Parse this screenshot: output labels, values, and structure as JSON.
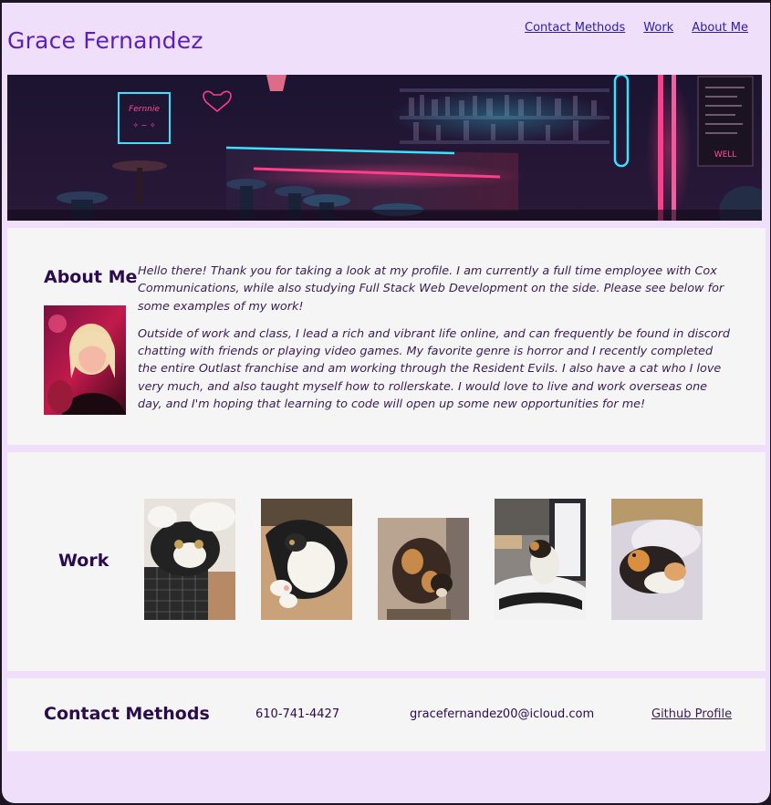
{
  "header": {
    "title": "Grace Fernandez",
    "nav": [
      {
        "label": "Contact Methods"
      },
      {
        "label": "Work"
      },
      {
        "label": "About Me"
      }
    ]
  },
  "hero": {
    "sign_text_1": "Fernnie",
    "sign_text_2": "WELL"
  },
  "about": {
    "heading": "About Me",
    "paragraph_1": "Hello there! Thank you for taking a look at my profile. I am currently a full time employee with Cox Communications, while also studying Full Stack Web Development on the side. Please see below for some examples of my work!",
    "paragraph_2": "Outside of work and class, I lead a rich and vibrant life online, and can frequently be found in discord chatting with friends or playing video games. My favorite genre is horror and I recently completed the entire Outlast franchise and am working through the Resident Evils. I also have a cat who I love very much, and also taught myself how to rollerskate. I would love to live and work overseas one day, and I'm hoping that learning to code will open up some new opportunities for me!"
  },
  "work": {
    "heading": "Work",
    "images": [
      {
        "name": "cat-photo-1"
      },
      {
        "name": "cat-photo-2"
      },
      {
        "name": "cat-photo-3"
      },
      {
        "name": "cat-photo-4"
      },
      {
        "name": "cat-photo-5"
      }
    ]
  },
  "contact": {
    "heading": "Contact Methods",
    "phone": "610-741-4427",
    "email": "gracefernandez00@icloud.com",
    "github": "Github Profile"
  },
  "colors": {
    "page_bg": "#f0dffa",
    "card_bg": "#f5f5f5",
    "title": "#5b1fb8",
    "heading": "#2b0a4d",
    "link": "#2b1f9e"
  }
}
